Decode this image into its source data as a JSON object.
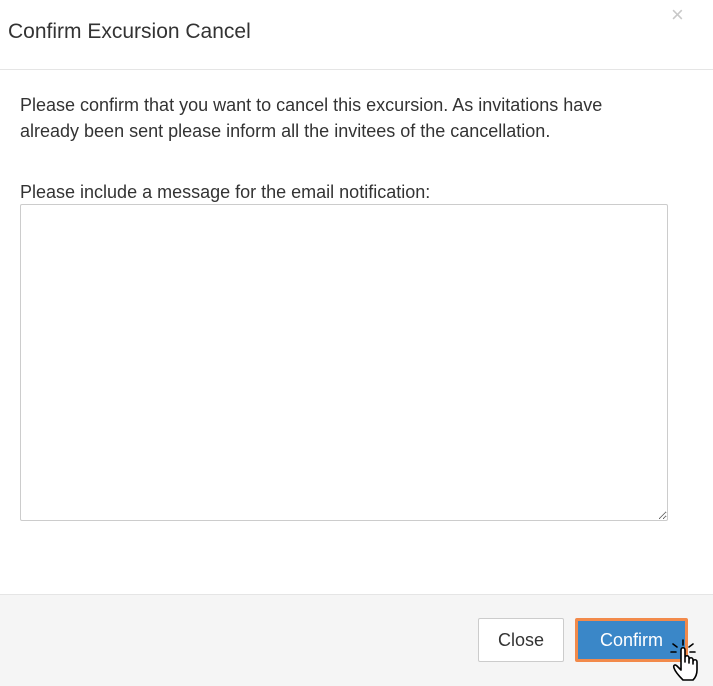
{
  "dialog": {
    "title": "Confirm Excursion Cancel",
    "close_glyph": "×"
  },
  "body": {
    "confirm_line1": "Please confirm that you want to cancel this excursion. As invitations have",
    "confirm_line2": "already been sent please inform all the invitees of the cancellation.",
    "message_label": "Please include a message for the email notification:",
    "message_value": ""
  },
  "footer": {
    "close_label": "Close",
    "confirm_label": "Confirm"
  },
  "colors": {
    "primary": "#3a87c8",
    "focus_outline": "#f28a4b",
    "footer_bg": "#f5f5f5"
  },
  "icons": {
    "close": "close-icon",
    "cursor": "hand-pointer-icon"
  }
}
